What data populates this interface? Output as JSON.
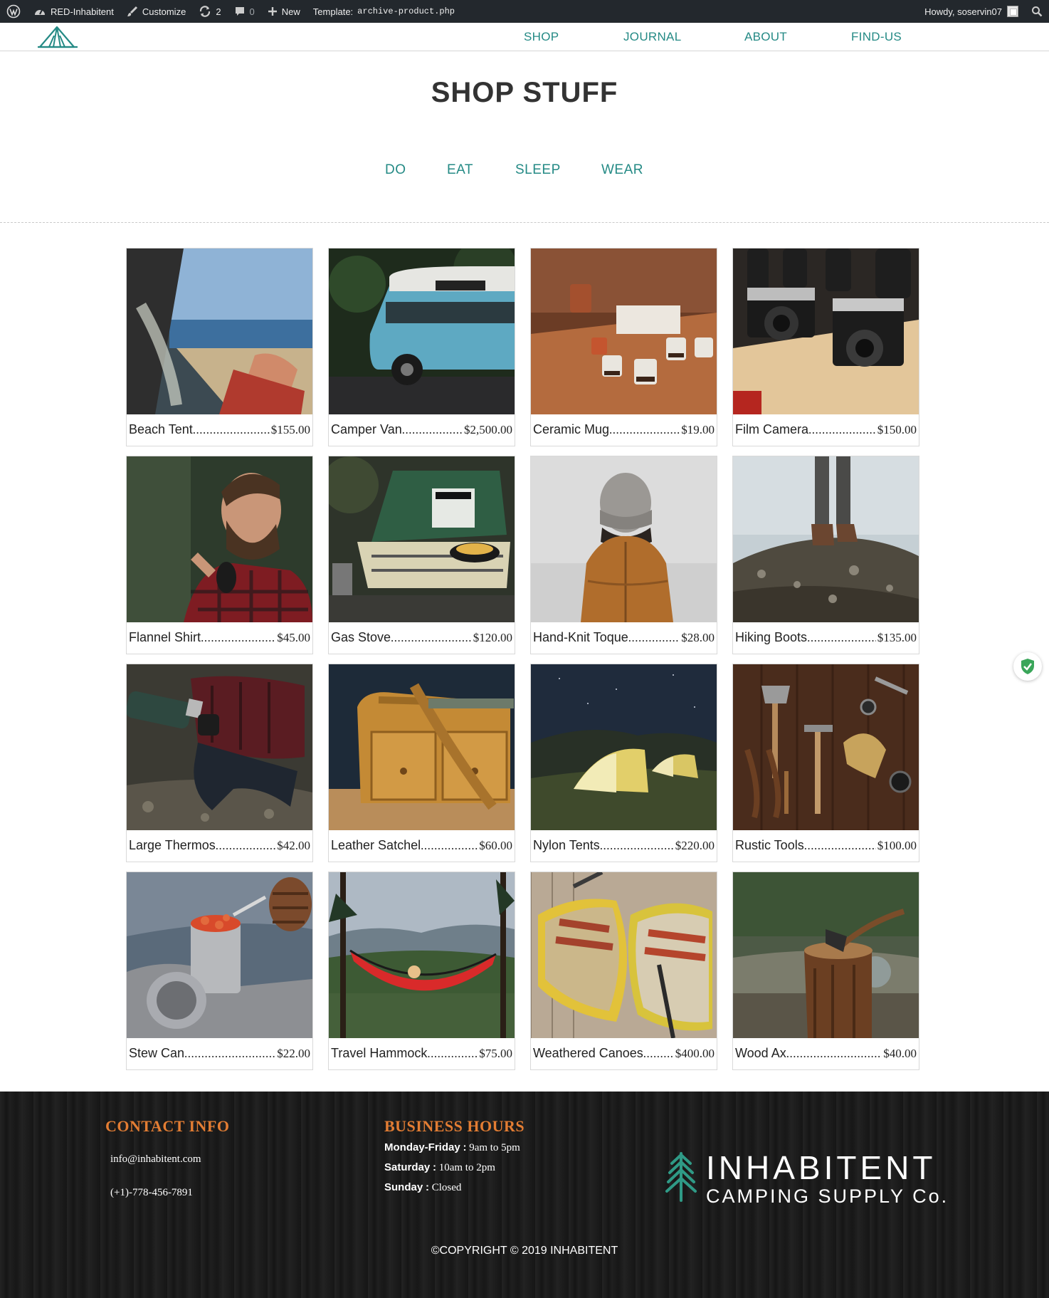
{
  "admin_bar": {
    "site_name": "RED-Inhabitent",
    "customize": "Customize",
    "updates_count": "2",
    "comments_count": "0",
    "new_label": "New",
    "template_label": "Template:",
    "template_file": "archive-product.php",
    "howdy": "Howdy, soservin07"
  },
  "nav": {
    "shop": "SHOP",
    "journal": "JOURNAL",
    "about": "ABOUT",
    "find_us": "FIND-US"
  },
  "page": {
    "title": "SHOP STUFF",
    "categories": [
      "DO",
      "EAT",
      "SLEEP",
      "WEAR"
    ]
  },
  "products": [
    {
      "name": "Beach Tent",
      "price": "$155.00"
    },
    {
      "name": "Camper Van",
      "price": "$2,500.00"
    },
    {
      "name": "Ceramic Mug",
      "price": "$19.00"
    },
    {
      "name": "Film Camera",
      "price": "$150.00"
    },
    {
      "name": "Flannel Shirt",
      "price": "$45.00"
    },
    {
      "name": "Gas Stove",
      "price": "$120.00"
    },
    {
      "name": "Hand-Knit Toque",
      "price": "$28.00"
    },
    {
      "name": "Hiking Boots",
      "price": "$135.00"
    },
    {
      "name": "Large Thermos",
      "price": "$42.00"
    },
    {
      "name": "Leather Satchel",
      "price": "$60.00"
    },
    {
      "name": "Nylon Tents",
      "price": "$220.00"
    },
    {
      "name": "Rustic Tools",
      "price": "$100.00"
    },
    {
      "name": "Stew Can",
      "price": "$22.00"
    },
    {
      "name": "Travel Hammock",
      "price": "$75.00"
    },
    {
      "name": "Weathered Canoes",
      "price": "$400.00"
    },
    {
      "name": "Wood Ax",
      "price": "$40.00"
    }
  ],
  "footer": {
    "contact_heading": "CONTACT INFO",
    "email": "info@inhabitent.com",
    "phone": "(+1)-778-456-7891",
    "hours_heading": "BUSINESS HOURS",
    "hours": [
      {
        "day": "Monday-Friday",
        "time": "9am to 5pm"
      },
      {
        "day": "Saturday",
        "time": "10am to 2pm"
      },
      {
        "day": "Sunday",
        "time": "Closed"
      }
    ],
    "brand_name": "INHABITENT",
    "brand_sub": "CAMPING SUPPLY Co.",
    "copyright": "©COPYRIGHT © 2019 INHABITENT"
  },
  "colors": {
    "accent": "#248a85",
    "footer_heading": "#e37d33",
    "admin_bar": "#23282d"
  },
  "icons": [
    "wordpress-icon",
    "dashboard-icon",
    "brush-icon",
    "refresh-icon",
    "comment-icon",
    "plus-icon",
    "avatar-icon",
    "search-icon",
    "shield-icon",
    "tent-logo-icon",
    "tree-icon"
  ]
}
